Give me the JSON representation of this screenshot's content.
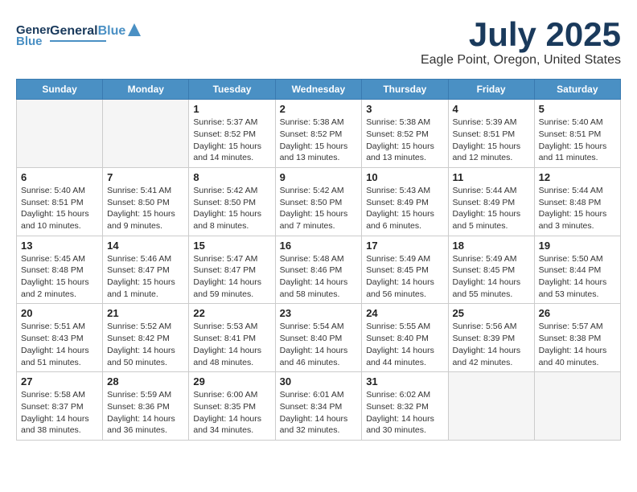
{
  "header": {
    "logo_general": "General",
    "logo_blue": "Blue",
    "title": "July 2025",
    "subtitle": "Eagle Point, Oregon, United States"
  },
  "calendar": {
    "days_of_week": [
      "Sunday",
      "Monday",
      "Tuesday",
      "Wednesday",
      "Thursday",
      "Friday",
      "Saturday"
    ],
    "weeks": [
      [
        {
          "day": "",
          "content": ""
        },
        {
          "day": "",
          "content": ""
        },
        {
          "day": "1",
          "content": "Sunrise: 5:37 AM\nSunset: 8:52 PM\nDaylight: 15 hours\nand 14 minutes."
        },
        {
          "day": "2",
          "content": "Sunrise: 5:38 AM\nSunset: 8:52 PM\nDaylight: 15 hours\nand 13 minutes."
        },
        {
          "day": "3",
          "content": "Sunrise: 5:38 AM\nSunset: 8:52 PM\nDaylight: 15 hours\nand 13 minutes."
        },
        {
          "day": "4",
          "content": "Sunrise: 5:39 AM\nSunset: 8:51 PM\nDaylight: 15 hours\nand 12 minutes."
        },
        {
          "day": "5",
          "content": "Sunrise: 5:40 AM\nSunset: 8:51 PM\nDaylight: 15 hours\nand 11 minutes."
        }
      ],
      [
        {
          "day": "6",
          "content": "Sunrise: 5:40 AM\nSunset: 8:51 PM\nDaylight: 15 hours\nand 10 minutes."
        },
        {
          "day": "7",
          "content": "Sunrise: 5:41 AM\nSunset: 8:50 PM\nDaylight: 15 hours\nand 9 minutes."
        },
        {
          "day": "8",
          "content": "Sunrise: 5:42 AM\nSunset: 8:50 PM\nDaylight: 15 hours\nand 8 minutes."
        },
        {
          "day": "9",
          "content": "Sunrise: 5:42 AM\nSunset: 8:50 PM\nDaylight: 15 hours\nand 7 minutes."
        },
        {
          "day": "10",
          "content": "Sunrise: 5:43 AM\nSunset: 8:49 PM\nDaylight: 15 hours\nand 6 minutes."
        },
        {
          "day": "11",
          "content": "Sunrise: 5:44 AM\nSunset: 8:49 PM\nDaylight: 15 hours\nand 5 minutes."
        },
        {
          "day": "12",
          "content": "Sunrise: 5:44 AM\nSunset: 8:48 PM\nDaylight: 15 hours\nand 3 minutes."
        }
      ],
      [
        {
          "day": "13",
          "content": "Sunrise: 5:45 AM\nSunset: 8:48 PM\nDaylight: 15 hours\nand 2 minutes."
        },
        {
          "day": "14",
          "content": "Sunrise: 5:46 AM\nSunset: 8:47 PM\nDaylight: 15 hours\nand 1 minute."
        },
        {
          "day": "15",
          "content": "Sunrise: 5:47 AM\nSunset: 8:47 PM\nDaylight: 14 hours\nand 59 minutes."
        },
        {
          "day": "16",
          "content": "Sunrise: 5:48 AM\nSunset: 8:46 PM\nDaylight: 14 hours\nand 58 minutes."
        },
        {
          "day": "17",
          "content": "Sunrise: 5:49 AM\nSunset: 8:45 PM\nDaylight: 14 hours\nand 56 minutes."
        },
        {
          "day": "18",
          "content": "Sunrise: 5:49 AM\nSunset: 8:45 PM\nDaylight: 14 hours\nand 55 minutes."
        },
        {
          "day": "19",
          "content": "Sunrise: 5:50 AM\nSunset: 8:44 PM\nDaylight: 14 hours\nand 53 minutes."
        }
      ],
      [
        {
          "day": "20",
          "content": "Sunrise: 5:51 AM\nSunset: 8:43 PM\nDaylight: 14 hours\nand 51 minutes."
        },
        {
          "day": "21",
          "content": "Sunrise: 5:52 AM\nSunset: 8:42 PM\nDaylight: 14 hours\nand 50 minutes."
        },
        {
          "day": "22",
          "content": "Sunrise: 5:53 AM\nSunset: 8:41 PM\nDaylight: 14 hours\nand 48 minutes."
        },
        {
          "day": "23",
          "content": "Sunrise: 5:54 AM\nSunset: 8:40 PM\nDaylight: 14 hours\nand 46 minutes."
        },
        {
          "day": "24",
          "content": "Sunrise: 5:55 AM\nSunset: 8:40 PM\nDaylight: 14 hours\nand 44 minutes."
        },
        {
          "day": "25",
          "content": "Sunrise: 5:56 AM\nSunset: 8:39 PM\nDaylight: 14 hours\nand 42 minutes."
        },
        {
          "day": "26",
          "content": "Sunrise: 5:57 AM\nSunset: 8:38 PM\nDaylight: 14 hours\nand 40 minutes."
        }
      ],
      [
        {
          "day": "27",
          "content": "Sunrise: 5:58 AM\nSunset: 8:37 PM\nDaylight: 14 hours\nand 38 minutes."
        },
        {
          "day": "28",
          "content": "Sunrise: 5:59 AM\nSunset: 8:36 PM\nDaylight: 14 hours\nand 36 minutes."
        },
        {
          "day": "29",
          "content": "Sunrise: 6:00 AM\nSunset: 8:35 PM\nDaylight: 14 hours\nand 34 minutes."
        },
        {
          "day": "30",
          "content": "Sunrise: 6:01 AM\nSunset: 8:34 PM\nDaylight: 14 hours\nand 32 minutes."
        },
        {
          "day": "31",
          "content": "Sunrise: 6:02 AM\nSunset: 8:32 PM\nDaylight: 14 hours\nand 30 minutes."
        },
        {
          "day": "",
          "content": ""
        },
        {
          "day": "",
          "content": ""
        }
      ]
    ]
  }
}
